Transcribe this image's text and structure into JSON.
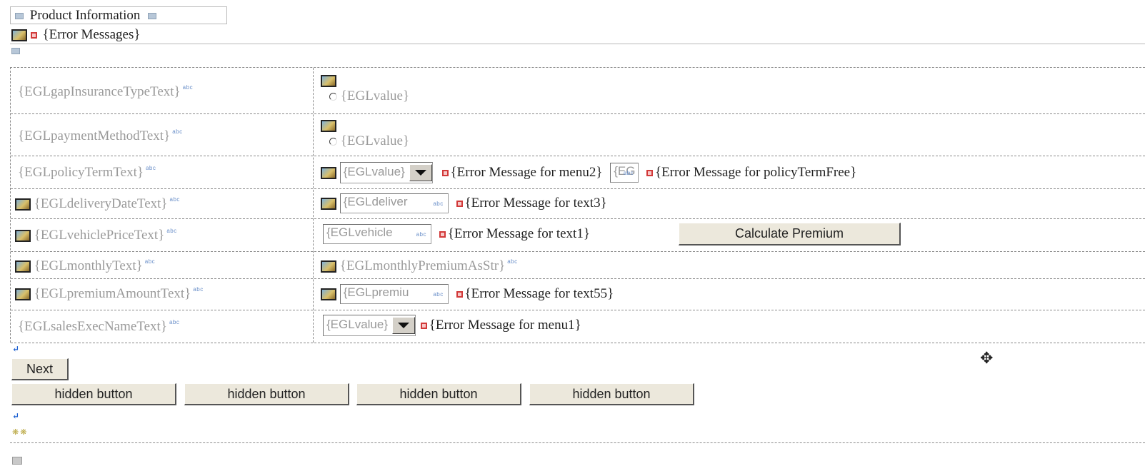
{
  "header": {
    "title": "Product Information",
    "error_messages": "{Error Messages}"
  },
  "rows": [
    {
      "label": "{EGLgapInsuranceTypeText}",
      "radio_value": "{EGLvalue}"
    },
    {
      "label": "{EGLpaymentMethodText}",
      "radio_value": "{EGLvalue}"
    },
    {
      "label": "{EGLpolicyTermText}",
      "select_value": "{EGLvalue}",
      "error1": "{Error Message for menu2}",
      "small_input": "{EG",
      "error2": "{Error Message for policyTermFree}"
    },
    {
      "label": "{EGLdeliveryDateText}",
      "input_value": "{EGLdeliver",
      "error": "{Error Message for text3}"
    },
    {
      "label": "{EGLvehiclePriceText}",
      "input_value": "{EGLvehicle",
      "error": "{Error Message for text1}",
      "button": "Calculate Premium"
    },
    {
      "label": "{EGLmonthlyText}",
      "value": "{EGLmonthlyPremiumAsStr}"
    },
    {
      "label": "{EGLpremiumAmountText}",
      "input_value": "{EGLpremiu",
      "error": "{Error Message for text55}"
    },
    {
      "label": "{EGLsalesExecNameText}",
      "select_value": "{EGLvalue}",
      "error": "{Error Message for menu1}"
    }
  ],
  "abc_tag": "abc",
  "buttons": {
    "next": "Next",
    "hidden": [
      "hidden button",
      "hidden button",
      "hidden button",
      "hidden button"
    ]
  },
  "icons": {
    "image": "image-icon",
    "error": "error-icon",
    "radio": "radio-icon",
    "move_cursor": "move-cursor-icon",
    "return": "return-marker-icon"
  },
  "glyphs": {
    "return_marker": "↵",
    "move_cursor": "✥",
    "stars": "❋❋"
  }
}
